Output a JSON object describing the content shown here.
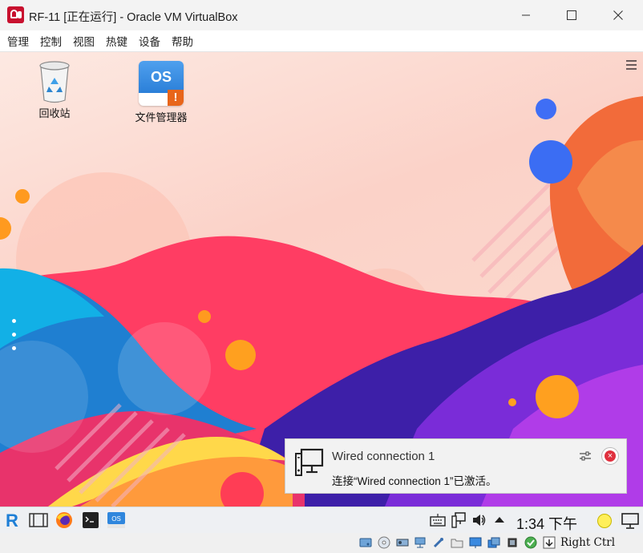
{
  "window": {
    "title": "RF-11 [正在运行] - Oracle VM VirtualBox"
  },
  "menubar": {
    "items": [
      "管理",
      "控制",
      "视图",
      "热键",
      "设备",
      "帮助"
    ]
  },
  "desktop": {
    "icons": [
      {
        "label": "回收站",
        "icon": "trash-icon"
      },
      {
        "label": "文件管理器",
        "icon": "file-manager-icon",
        "badge_text": "OS"
      }
    ]
  },
  "notification": {
    "title": "Wired connection 1",
    "body": "连接“Wired connection 1”已激活。"
  },
  "taskbar": {
    "start_letter": "R",
    "clock": "1:34 下午"
  },
  "statusbar": {
    "host_key": "Right Ctrl"
  },
  "colors": {
    "accent_blue": "#1e7fd6",
    "close_red": "#e0303e"
  }
}
